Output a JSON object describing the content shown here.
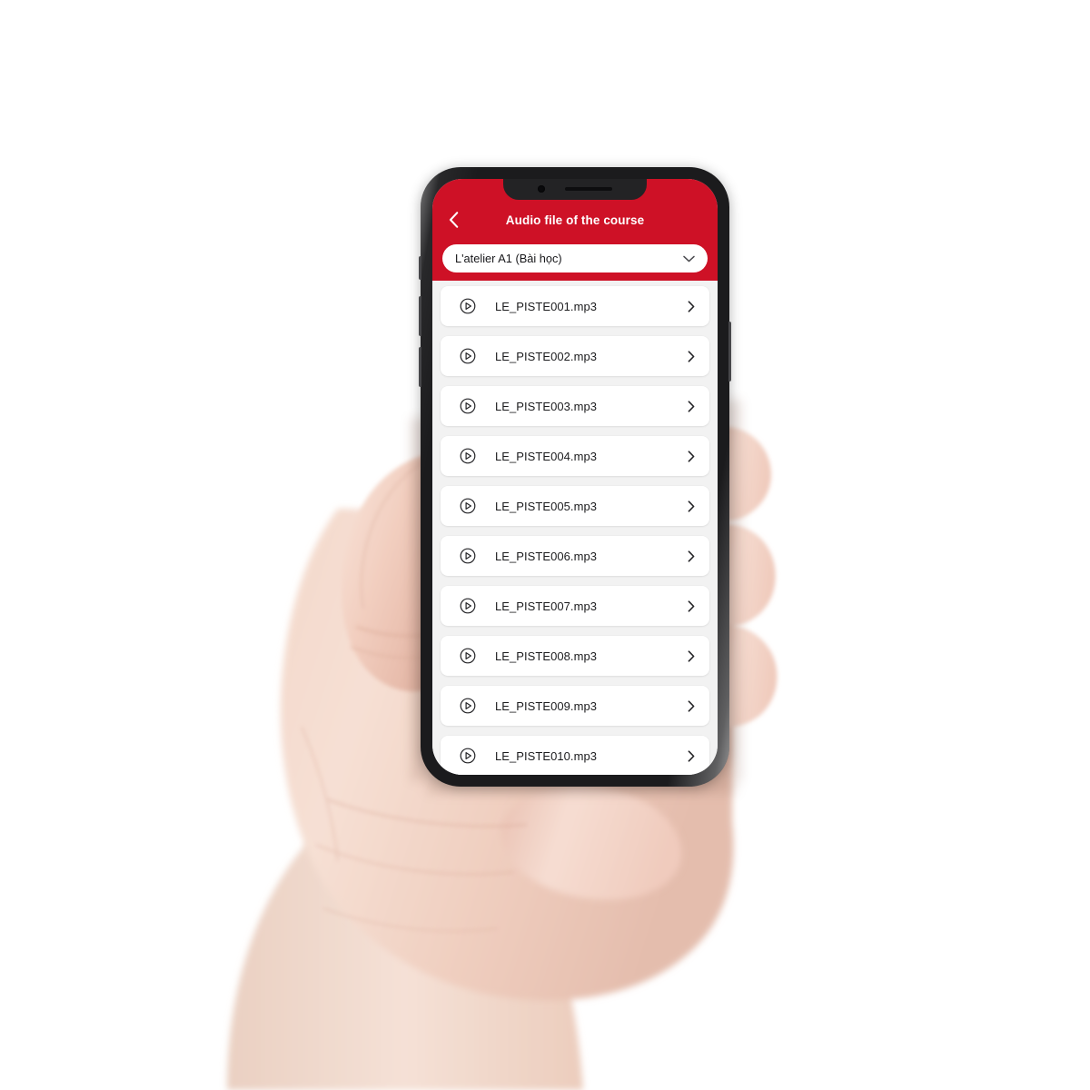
{
  "theme": {
    "brand_red": "#CE1126",
    "screen_bg": "#F2F2F2",
    "card_bg": "#FFFFFF",
    "text_color": "#1C1C1E",
    "header_text": "#FFFFFF"
  },
  "header": {
    "title": "Audio file of the course",
    "back_icon": "chevron-left-icon"
  },
  "course_select": {
    "value": "L'atelier A1 (Bài học)",
    "chevron_icon": "chevron-down-icon"
  },
  "audio_list": {
    "row_play_icon": "play-circle-icon",
    "row_chevron_icon": "chevron-right-icon",
    "items": [
      {
        "name": "LE_PISTE001.mp3"
      },
      {
        "name": "LE_PISTE002.mp3"
      },
      {
        "name": "LE_PISTE003.mp3"
      },
      {
        "name": "LE_PISTE004.mp3"
      },
      {
        "name": "LE_PISTE005.mp3"
      },
      {
        "name": "LE_PISTE006.mp3"
      },
      {
        "name": "LE_PISTE007.mp3"
      },
      {
        "name": "LE_PISTE008.mp3"
      },
      {
        "name": "LE_PISTE009.mp3"
      },
      {
        "name": "LE_PISTE010.mp3"
      }
    ]
  },
  "device": {
    "notch_camera_icon": "front-camera-icon",
    "notch_speaker_icon": "earpiece-speaker-icon",
    "buttons": [
      "silent-switch",
      "volume-up-button",
      "volume-down-button",
      "power-button"
    ]
  }
}
